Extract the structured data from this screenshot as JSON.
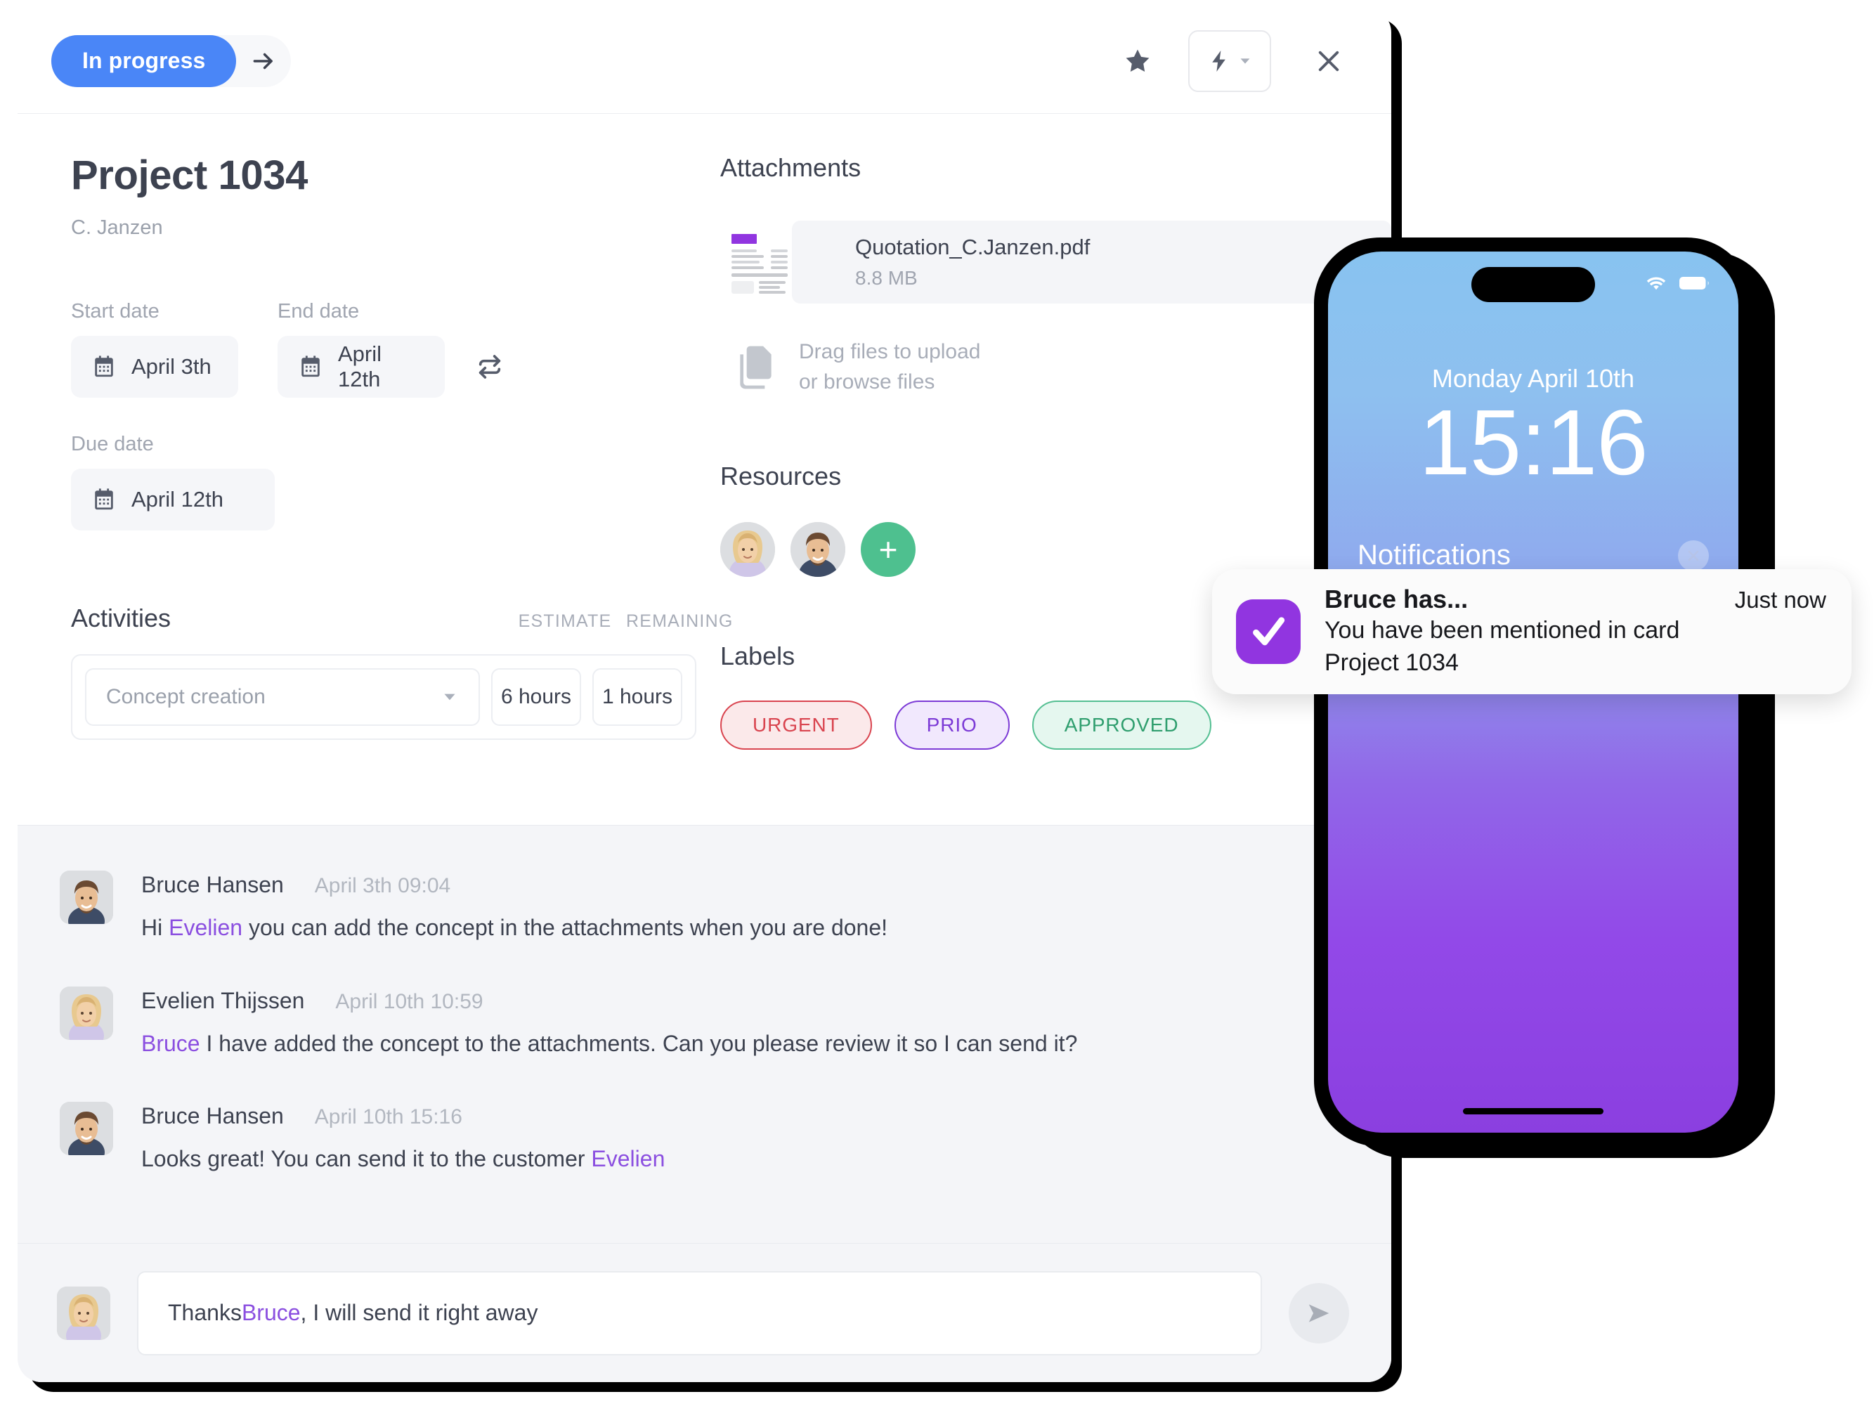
{
  "topbar": {
    "status_label": "In progress",
    "next_arrow_icon": "arrow-right-icon",
    "favorite_icon": "star-icon",
    "quick_action_icon": "lightning-bolt-icon",
    "quick_action_caret_icon": "chevron-down-icon",
    "close_icon": "close-icon"
  },
  "project": {
    "title": "Project 1034",
    "subtitle": "C. Janzen"
  },
  "dates": {
    "start_label": "Start date",
    "start_value": "April 3th",
    "end_label": "End date",
    "end_value": "April 12th",
    "due_label": "Due date",
    "due_value": "April 12th",
    "swap_icon": "swap-arrows-icon",
    "calendar_icon": "calendar-icon"
  },
  "activities": {
    "title": "Activities",
    "col_estimate": "ESTIMATE",
    "col_remaining": "REMAINING",
    "rows": [
      {
        "name": "Concept creation",
        "estimate": "6 hours",
        "remaining": "1 hours"
      }
    ]
  },
  "attachments": {
    "title": "Attachments",
    "file_name": "Quotation_C.Janzen.pdf",
    "file_size": "8.8 MB",
    "drop_line1": "Drag files to upload",
    "drop_line2": "or browse files",
    "drop_icon": "copy-files-icon"
  },
  "resources": {
    "title": "Resources",
    "members": [
      "Evelien Thijssen",
      "Bruce Hansen"
    ],
    "add_label": "+",
    "add_color": "#4ec08f"
  },
  "labels": {
    "title": "Labels",
    "chips": [
      {
        "text": "URGENT",
        "color": "#d9444f",
        "bg": "#fbe9ea",
        "border": "#d9444f"
      },
      {
        "text": "PRIO",
        "color": "#7c3ad6",
        "bg": "#f1e8fd",
        "border": "#7c3ad6"
      },
      {
        "text": "APPROVED",
        "color": "#2f9e6e",
        "bg": "#e5f7ef",
        "border": "#54bf92"
      }
    ]
  },
  "comments": [
    {
      "author": "Bruce Hansen",
      "time": "April 3th 09:04",
      "pre": "Hi ",
      "mention": "Evelien",
      "post": " you can add the concept in the attachments when you are done!",
      "avatar": "bruce"
    },
    {
      "author": "Evelien Thijssen",
      "time": "April 10th 10:59",
      "pre": "",
      "mention": "Bruce",
      "post": " I have added the concept to the attachments. Can you please review it so I can send it?",
      "avatar": "evelien"
    },
    {
      "author": "Bruce Hansen",
      "time": "April 10th 15:16",
      "pre": "Looks great! You can send it to the customer ",
      "mention": "Evelien",
      "post": "",
      "avatar": "bruce"
    }
  ],
  "composer": {
    "pre": "Thanks ",
    "mention": "Bruce",
    "post": ", I will send it right away",
    "send_icon": "send-paper-plane-icon"
  },
  "phone": {
    "date": "Monday April 10th",
    "time": "15:16",
    "notifications_label": "Notifications",
    "clear_icon": "close-icon",
    "wifi_icon": "wifi-icon",
    "battery_icon": "battery-icon"
  },
  "toast": {
    "title": "Bruce has...",
    "when": "Just now",
    "message_line1": "You have been mentioned in card",
    "message_line2": "Project 1034",
    "app_icon": "checkmark-app-icon",
    "app_icon_color": "#9135e0"
  },
  "colors": {
    "accent_blue": "#4a86f7",
    "mention_purple": "#8b4fe0",
    "green": "#4ec08f"
  }
}
